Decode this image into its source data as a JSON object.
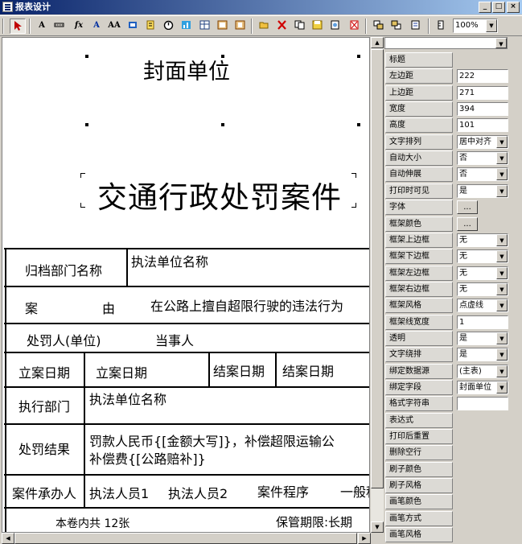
{
  "window": {
    "title": "报表设计",
    "min": "_",
    "max": "□",
    "close": "×"
  },
  "toolbar": {
    "zoom": "100%",
    "text_button": "A",
    "func_button": "fx",
    "font_small": "A",
    "font_large": "AA"
  },
  "report": {
    "cover_unit": "封面单位",
    "main_title": "交通行政处罚案件",
    "rows": {
      "archive_label": "归档部门名称",
      "archive_value": "执法单位名称",
      "case_label_1": "案",
      "case_label_2": "由",
      "case_value": "在公路上擅自超限行驶的违法行为",
      "party_label": "处罚人(单位)",
      "party_value": "当事人",
      "file_date_label": "立案日期",
      "file_date_value": "立案日期",
      "close_date_label": "结案日期",
      "close_date_value": "结案日期",
      "exec_dept_label": "执行部门",
      "exec_dept_value": "执法单位名称",
      "result_label": "处罚结果",
      "result_line1": "罚款人民币{[金额大写]}，补偿超限运输公",
      "result_line2": "补偿费{[公路赔补]}",
      "handler_label": "案件承办人",
      "handler_1": "执法人员1",
      "handler_2": "执法人员2",
      "procedure_label": "案件程序",
      "procedure_value": "一般程",
      "volume_text": "本卷内共  12张",
      "retention_text": "保管期限:长期"
    }
  },
  "properties": {
    "object_selector": "",
    "rows": [
      {
        "label": "标题",
        "value": "",
        "type": "none"
      },
      {
        "label": "左边距",
        "value": "222",
        "type": "text"
      },
      {
        "label": "上边距",
        "value": "271",
        "type": "text"
      },
      {
        "label": "宽度",
        "value": "394",
        "type": "text"
      },
      {
        "label": "高度",
        "value": "101",
        "type": "text"
      },
      {
        "label": "文字排列",
        "value": "居中对齐",
        "type": "dropdown"
      },
      {
        "label": "自动大小",
        "value": "否",
        "type": "dropdown"
      },
      {
        "label": "自动伸展",
        "value": "否",
        "type": "dropdown"
      },
      {
        "label": "打印时可见",
        "value": "是",
        "type": "dropdown"
      },
      {
        "label": "字体",
        "value": "...",
        "type": "button"
      },
      {
        "label": "框架颜色",
        "value": "...",
        "type": "button"
      },
      {
        "label": "框架上边框",
        "value": "无",
        "type": "dropdown"
      },
      {
        "label": "框架下边框",
        "value": "无",
        "type": "dropdown"
      },
      {
        "label": "框架左边框",
        "value": "无",
        "type": "dropdown"
      },
      {
        "label": "框架右边框",
        "value": "无",
        "type": "dropdown"
      },
      {
        "label": "框架风格",
        "value": "点虚线",
        "type": "dropdown"
      },
      {
        "label": "框架线宽度",
        "value": "1",
        "type": "text"
      },
      {
        "label": "透明",
        "value": "是",
        "type": "dropdown"
      },
      {
        "label": "文字绕排",
        "value": "是",
        "type": "dropdown"
      },
      {
        "label": "绑定数据源",
        "value": "(主表)",
        "type": "dropdown"
      },
      {
        "label": "绑定字段",
        "value": "封面单位",
        "type": "dropdown"
      },
      {
        "label": "格式字符串",
        "value": "",
        "type": "text"
      },
      {
        "label": "表达式",
        "value": "",
        "type": "none"
      },
      {
        "label": "打印后重置",
        "value": "",
        "type": "none"
      },
      {
        "label": "删除空行",
        "value": "",
        "type": "none"
      },
      {
        "label": "刷子颜色",
        "value": "",
        "type": "none"
      },
      {
        "label": "刷子风格",
        "value": "",
        "type": "none"
      },
      {
        "label": "画笔颜色",
        "value": "",
        "type": "none"
      },
      {
        "label": "画笔方式",
        "value": "",
        "type": "none"
      },
      {
        "label": "画笔风格",
        "value": "",
        "type": "none"
      }
    ]
  },
  "colors": {
    "titlebar_start": "#0a246a",
    "titlebar_end": "#a6caf0",
    "face": "#d4d0c8"
  }
}
